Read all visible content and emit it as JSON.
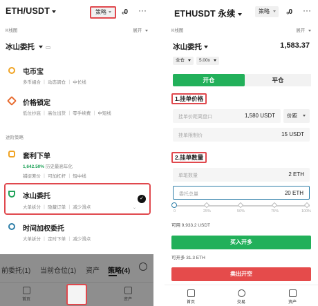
{
  "left": {
    "pair": "ETH/USDT",
    "strategy_btn": "策略",
    "chart_icon": "₀0",
    "kline_label": "K线图",
    "kline_expand": "展开",
    "iceberg_header": "冰山委托",
    "menu": [
      {
        "title": "屯币宝",
        "desc": "多币組合 ｜ 动态调仓 ｜ 中长线",
        "icon_color": "#f0a323"
      },
      {
        "title": "价格锁定",
        "desc": "低位抄底 ｜ 高位出货 ｜ 零手续费 ｜ 中短线",
        "icon_color": "#e76b2f"
      },
      {
        "title": "套利下单",
        "desc_rate": "1,642.50%",
        "desc_rate_suffix": "历史最高年化",
        "desc2": "捕捉差价 ｜ 可加杠杆 ｜ 短中线",
        "icon_color": "#f0a323"
      },
      {
        "title": "冰山委托",
        "desc": "大单拆分 ｜ 隐藏订单 ｜ 减少滑点",
        "icon_color": "#21a35a"
      },
      {
        "title": "时间加权委托",
        "desc": "大单拆分 ｜ 定时下单 ｜ 减少滑点",
        "icon_color": "#2d7ea8"
      }
    ],
    "section_label": "进阶策略",
    "tabs": [
      "前委托(1)",
      "当前仓位(1)",
      "资产",
      "策略(4)"
    ],
    "nav": [
      "首页",
      "交易",
      "资产"
    ]
  },
  "right": {
    "pair": "ETHUSDT 永续",
    "strategy_btn": "策略",
    "chart_icon": "₀0",
    "kline_label": "K线图",
    "kline_expand": "展开",
    "iceberg": "冰山委托",
    "price": "1,583.37",
    "chip_margin": "全仓",
    "chip_leverage": "5.00x",
    "open_tab": "开仓",
    "close_tab": "平仓",
    "section1": "1.挂单价格",
    "order_distance_ph": "挂单价距离盘口",
    "order_distance_val": "1,580",
    "order_distance_unit": "USDT",
    "price_btn": "价距",
    "order_limit_ph": "挂单限制价",
    "order_limit_val": "15",
    "order_limit_unit": "USDT",
    "section2": "2.挂单数量",
    "single_qty_ph": "单笔数量",
    "single_qty_val": "2",
    "single_qty_unit": "ETH",
    "total_qty_ph": "委托总量",
    "total_qty_val": "20",
    "total_qty_unit": "ETH",
    "slider_pcts": [
      "0",
      "25%",
      "50%",
      "75%",
      "100%"
    ],
    "available": "可用 9,933.2 USDT",
    "buy_btn": "买入开多",
    "can_open": "可开多 31.3 ETH",
    "sell_btn": "卖出开空",
    "nav": [
      "首页",
      "交易",
      "资产"
    ]
  },
  "colors": {
    "red_highlight": "#e0484d",
    "green": "#22b05a",
    "sell_red": "#e54b4b",
    "blue_focus": "#2d7ea8"
  }
}
